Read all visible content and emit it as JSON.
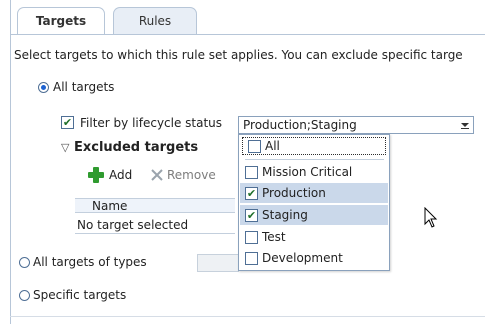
{
  "tabs": [
    {
      "label": "Targets"
    },
    {
      "label": "Rules"
    }
  ],
  "description": "Select targets to which this rule set applies. You can exclude specific targe",
  "radios": {
    "all_targets": "All targets",
    "all_types": "All targets of types",
    "specific": "Specific targets"
  },
  "filter": {
    "label": "Filter by lifecycle status",
    "value": "Production;Staging",
    "checked": true
  },
  "excluded": {
    "title": "Excluded targets",
    "add": "Add",
    "remove": "Remove"
  },
  "table": {
    "columns": [
      "Name"
    ],
    "empty": "No target selected"
  },
  "dropdown": {
    "options": [
      {
        "label": "All",
        "checked": false
      },
      {
        "label": "Mission Critical",
        "checked": false
      },
      {
        "label": "Production",
        "checked": true
      },
      {
        "label": "Staging",
        "checked": true
      },
      {
        "label": "Test",
        "checked": false
      },
      {
        "label": "Development",
        "checked": false
      }
    ]
  },
  "icons": [
    "plus-icon",
    "remove-x-icon",
    "chevron-down-icon",
    "disclosure-triangle-icon",
    "mouse-cursor-icon"
  ],
  "colors": {
    "accent": "#1d62d1",
    "border": "#b7c6d8",
    "highlight": "#cad8ea",
    "add_green": "#2f9b2f"
  }
}
